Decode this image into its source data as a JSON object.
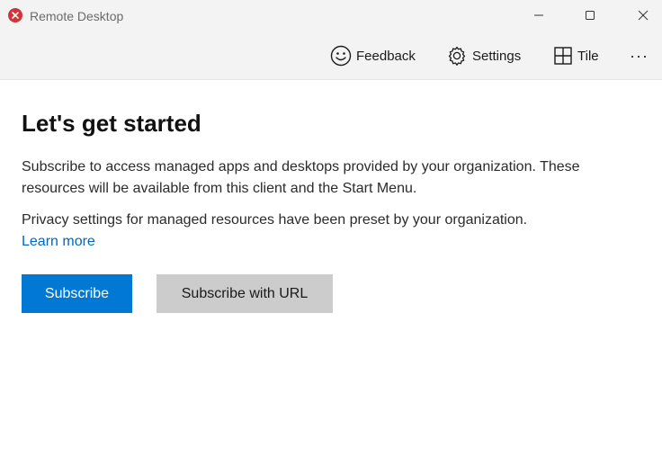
{
  "window": {
    "title": "Remote Desktop",
    "app_icon": "remote-desktop-icon",
    "accent_icon_color": "#d13438",
    "controls": [
      "minimize-icon",
      "maximize-icon",
      "close-icon"
    ]
  },
  "toolbar": {
    "feedback_label": "Feedback",
    "feedback_icon": "smiley-icon",
    "settings_label": "Settings",
    "settings_icon": "gear-icon",
    "tile_label": "Tile",
    "tile_icon": "tile-icon",
    "more_label": "···"
  },
  "main": {
    "heading": "Let's get started",
    "description": "Subscribe to access managed apps and desktops provided by your organization. These resources will be available from this client and the Start Menu.",
    "privacy_text": "Privacy settings for managed resources have been preset by your organization.",
    "learn_more_label": "Learn more",
    "subscribe_label": "Subscribe",
    "subscribe_url_label": "Subscribe with URL"
  },
  "colors": {
    "primary_button": "#0078d4",
    "secondary_button": "#cccccc",
    "link": "#0067c0",
    "chrome": "#f3f3f3"
  }
}
